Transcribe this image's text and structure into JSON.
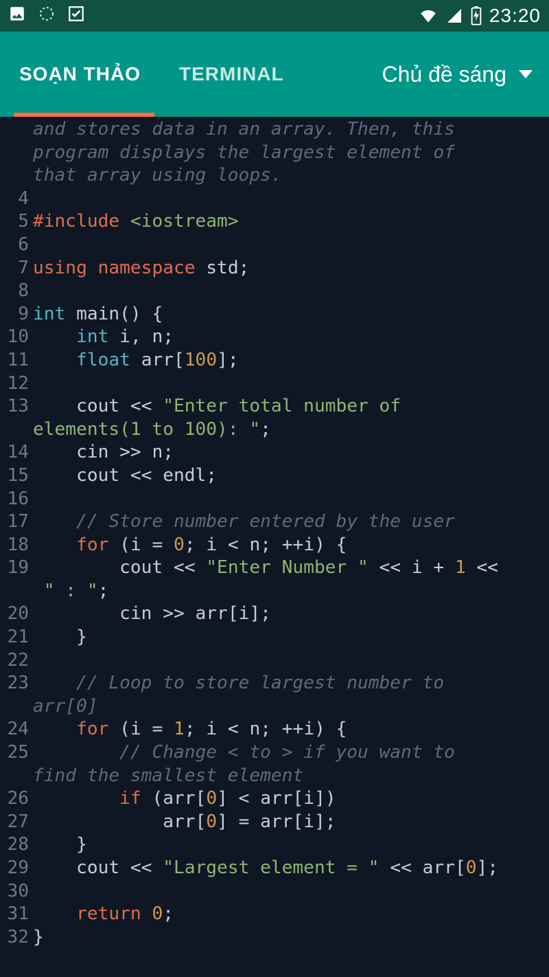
{
  "status": {
    "time": "23:20"
  },
  "tabs": {
    "editor": "SOẠN THẢO",
    "terminal": "TERMINAL"
  },
  "theme": {
    "label": "Chủ đề sáng"
  },
  "lines": [
    {
      "n": 3,
      "wrap": true,
      "tokens": [
        [
          "c-comment",
          "and stores data in an array. Then, this "
        ]
      ]
    },
    {
      "n": 3,
      "wrap": true,
      "tokens": [
        [
          "c-comment",
          "program displays the largest element of "
        ]
      ]
    },
    {
      "n": 3,
      "wrap": true,
      "tokens": [
        [
          "c-comment",
          "that array using loops."
        ]
      ]
    },
    {
      "n": 4,
      "wrap": false,
      "tokens": []
    },
    {
      "n": 5,
      "wrap": false,
      "tokens": [
        [
          "c-pre",
          "#include "
        ],
        [
          "c-inc",
          "<iostream>"
        ]
      ]
    },
    {
      "n": 6,
      "wrap": false,
      "tokens": []
    },
    {
      "n": 7,
      "wrap": false,
      "tokens": [
        [
          "c-pre",
          "using "
        ],
        [
          "c-pre",
          "namespace "
        ],
        [
          "c-ident",
          "std"
        ],
        [
          "c-punct",
          ";"
        ]
      ]
    },
    {
      "n": 8,
      "wrap": false,
      "tokens": []
    },
    {
      "n": 9,
      "wrap": false,
      "tokens": [
        [
          "c-type",
          "int "
        ],
        [
          "c-ident",
          "main"
        ],
        [
          "c-punct",
          "() {"
        ]
      ]
    },
    {
      "n": 10,
      "wrap": false,
      "tokens": [
        [
          "c-ident",
          "    "
        ],
        [
          "c-type",
          "int "
        ],
        [
          "c-ident",
          "i"
        ],
        [
          "c-punct",
          ", "
        ],
        [
          "c-ident",
          "n"
        ],
        [
          "c-punct",
          ";"
        ]
      ]
    },
    {
      "n": 11,
      "wrap": false,
      "tokens": [
        [
          "c-ident",
          "    "
        ],
        [
          "c-type",
          "float "
        ],
        [
          "c-ident",
          "arr"
        ],
        [
          "c-punct",
          "["
        ],
        [
          "c-num",
          "100"
        ],
        [
          "c-punct",
          "];"
        ]
      ]
    },
    {
      "n": 12,
      "wrap": false,
      "tokens": []
    },
    {
      "n": 13,
      "wrap": false,
      "tokens": [
        [
          "c-ident",
          "    cout "
        ],
        [
          "c-op",
          "<< "
        ],
        [
          "c-str",
          "\"Enter total number of "
        ]
      ]
    },
    {
      "n": 13,
      "wrap": true,
      "tokens": [
        [
          "c-str",
          "elements(1 to 100): \""
        ],
        [
          "c-punct",
          ";"
        ]
      ]
    },
    {
      "n": 14,
      "wrap": false,
      "tokens": [
        [
          "c-ident",
          "    cin "
        ],
        [
          "c-op",
          ">> "
        ],
        [
          "c-ident",
          "n"
        ],
        [
          "c-punct",
          ";"
        ]
      ]
    },
    {
      "n": 15,
      "wrap": false,
      "tokens": [
        [
          "c-ident",
          "    cout "
        ],
        [
          "c-op",
          "<< "
        ],
        [
          "c-ident",
          "endl"
        ],
        [
          "c-punct",
          ";"
        ]
      ]
    },
    {
      "n": 16,
      "wrap": false,
      "tokens": []
    },
    {
      "n": 17,
      "wrap": false,
      "tokens": [
        [
          "c-ident",
          "    "
        ],
        [
          "c-comment",
          "// Store number entered by the user"
        ]
      ]
    },
    {
      "n": 18,
      "wrap": false,
      "tokens": [
        [
          "c-ident",
          "    "
        ],
        [
          "c-kw",
          "for "
        ],
        [
          "c-punct",
          "("
        ],
        [
          "c-ident",
          "i "
        ],
        [
          "c-op",
          "= "
        ],
        [
          "c-num",
          "0"
        ],
        [
          "c-punct",
          "; "
        ],
        [
          "c-ident",
          "i "
        ],
        [
          "c-op",
          "< "
        ],
        [
          "c-ident",
          "n"
        ],
        [
          "c-punct",
          "; "
        ],
        [
          "c-op",
          "++"
        ],
        [
          "c-ident",
          "i"
        ],
        [
          "c-punct",
          ") {"
        ]
      ]
    },
    {
      "n": 19,
      "wrap": false,
      "tokens": [
        [
          "c-ident",
          "        cout "
        ],
        [
          "c-op",
          "<< "
        ],
        [
          "c-str",
          "\"Enter Number \""
        ],
        [
          "c-op",
          " << "
        ],
        [
          "c-ident",
          "i "
        ],
        [
          "c-op",
          "+ "
        ],
        [
          "c-num",
          "1"
        ],
        [
          "c-op",
          " <<"
        ]
      ]
    },
    {
      "n": 19,
      "wrap": true,
      "tokens": [
        [
          "c-str",
          " \" : \""
        ],
        [
          "c-punct",
          ";"
        ]
      ]
    },
    {
      "n": 20,
      "wrap": false,
      "tokens": [
        [
          "c-ident",
          "        cin "
        ],
        [
          "c-op",
          ">> "
        ],
        [
          "c-ident",
          "arr"
        ],
        [
          "c-punct",
          "["
        ],
        [
          "c-ident",
          "i"
        ],
        [
          "c-punct",
          "];"
        ]
      ]
    },
    {
      "n": 21,
      "wrap": false,
      "tokens": [
        [
          "c-punct",
          "    }"
        ]
      ]
    },
    {
      "n": 22,
      "wrap": false,
      "tokens": []
    },
    {
      "n": 23,
      "wrap": false,
      "tokens": [
        [
          "c-ident",
          "    "
        ],
        [
          "c-comment",
          "// Loop to store largest number to "
        ]
      ]
    },
    {
      "n": 23,
      "wrap": true,
      "tokens": [
        [
          "c-comment",
          "arr[0]"
        ]
      ]
    },
    {
      "n": 24,
      "wrap": false,
      "tokens": [
        [
          "c-ident",
          "    "
        ],
        [
          "c-kw",
          "for "
        ],
        [
          "c-punct",
          "("
        ],
        [
          "c-ident",
          "i "
        ],
        [
          "c-op",
          "= "
        ],
        [
          "c-num",
          "1"
        ],
        [
          "c-punct",
          "; "
        ],
        [
          "c-ident",
          "i "
        ],
        [
          "c-op",
          "< "
        ],
        [
          "c-ident",
          "n"
        ],
        [
          "c-punct",
          "; "
        ],
        [
          "c-op",
          "++"
        ],
        [
          "c-ident",
          "i"
        ],
        [
          "c-punct",
          ") {"
        ]
      ]
    },
    {
      "n": 25,
      "wrap": false,
      "tokens": [
        [
          "c-ident",
          "        "
        ],
        [
          "c-comment",
          "// Change < to > if you want to "
        ]
      ]
    },
    {
      "n": 25,
      "wrap": true,
      "tokens": [
        [
          "c-comment",
          "find the smallest element"
        ]
      ]
    },
    {
      "n": 26,
      "wrap": false,
      "tokens": [
        [
          "c-ident",
          "        "
        ],
        [
          "c-kw",
          "if "
        ],
        [
          "c-punct",
          "("
        ],
        [
          "c-ident",
          "arr"
        ],
        [
          "c-punct",
          "["
        ],
        [
          "c-num",
          "0"
        ],
        [
          "c-punct",
          "] "
        ],
        [
          "c-op",
          "< "
        ],
        [
          "c-ident",
          "arr"
        ],
        [
          "c-punct",
          "["
        ],
        [
          "c-ident",
          "i"
        ],
        [
          "c-punct",
          "])"
        ]
      ]
    },
    {
      "n": 27,
      "wrap": false,
      "tokens": [
        [
          "c-ident",
          "            arr"
        ],
        [
          "c-punct",
          "["
        ],
        [
          "c-num",
          "0"
        ],
        [
          "c-punct",
          "] "
        ],
        [
          "c-op",
          "= "
        ],
        [
          "c-ident",
          "arr"
        ],
        [
          "c-punct",
          "["
        ],
        [
          "c-ident",
          "i"
        ],
        [
          "c-punct",
          "];"
        ]
      ]
    },
    {
      "n": 28,
      "wrap": false,
      "tokens": [
        [
          "c-punct",
          "    }"
        ]
      ]
    },
    {
      "n": 29,
      "wrap": false,
      "tokens": [
        [
          "c-ident",
          "    cout "
        ],
        [
          "c-op",
          "<< "
        ],
        [
          "c-str",
          "\"Largest element = \""
        ],
        [
          "c-op",
          " << "
        ],
        [
          "c-ident",
          "arr"
        ],
        [
          "c-punct",
          "["
        ],
        [
          "c-num",
          "0"
        ],
        [
          "c-punct",
          "];"
        ]
      ]
    },
    {
      "n": 30,
      "wrap": false,
      "tokens": []
    },
    {
      "n": 31,
      "wrap": false,
      "tokens": [
        [
          "c-ident",
          "    "
        ],
        [
          "c-kw",
          "return "
        ],
        [
          "c-num",
          "0"
        ],
        [
          "c-punct",
          ";"
        ]
      ]
    },
    {
      "n": 32,
      "wrap": false,
      "tokens": [
        [
          "c-punct",
          "}"
        ]
      ]
    }
  ]
}
